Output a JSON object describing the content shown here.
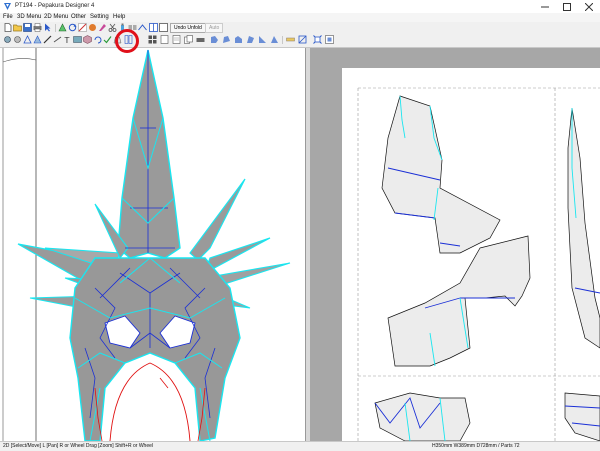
{
  "window": {
    "title": "PT194 - Pepakura Designer 4",
    "icon": "pepakura-app-icon"
  },
  "menu": {
    "items": [
      "File",
      "3D Menu",
      "2D Menu",
      "Other",
      "Setting",
      "Help"
    ]
  },
  "toolbar": {
    "undo_unfold_label": "Undo Unfold",
    "auto_label": "Auto"
  },
  "statusbar": {
    "left_text": "2D [Select/Move] L [Pan] R or Wheel Drag [Zoom] Shift+R or Wheel",
    "right_text": "H350mm W389mm D728mm / Parts 72"
  },
  "annotation": {
    "highlight_color": "#e0101a",
    "note": "red-circle-around-toolbar-button"
  },
  "colors": {
    "mountain_edge": "#19e6f0",
    "valley_edge": "#1a2fd6",
    "cut_edge": "#e01010",
    "model_fill": "#9a9a9a",
    "paper": "#ffffff",
    "background_2d": "#a7a7a7"
  }
}
